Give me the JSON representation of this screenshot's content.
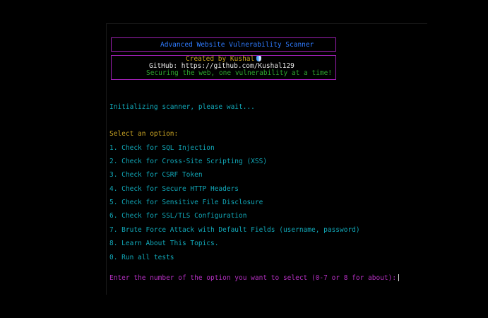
{
  "banner": {
    "title": "Advanced Website Vulnerability Scanner",
    "created_by": "Created by Kushal",
    "github": "GitHub: https://github.com/Kushal129",
    "tagline": "Securing the web, one vulnerability at a time!"
  },
  "status": "Initializing scanner, please wait...",
  "menu": {
    "heading": "Select an option:",
    "items": [
      "1. Check for SQL Injection",
      "2. Check for Cross-Site Scripting (XSS)",
      "3. Check for CSRF Token",
      "4. Check for Secure HTTP Headers",
      "5. Check for Sensitive File Disclosure",
      "6. Check for SSL/TLS Configuration",
      "7. Brute Force Attack with Default Fields (username, password)",
      "8. Learn About This Topics.",
      "0. Run all tests"
    ]
  },
  "prompt": "Enter the number of the option you want to select (0-7 or 8 for about):",
  "icons": {
    "credit": "shield-icon",
    "cursor": "text-cursor"
  },
  "colors": {
    "background": "#000000",
    "title": "#2f7bff",
    "border": "#9b1fb0",
    "credit": "#c8a324",
    "github": "#e8e8e8",
    "tagline": "#2ea62e",
    "menu": "#11a8b8",
    "prompt": "#b32fc0"
  }
}
